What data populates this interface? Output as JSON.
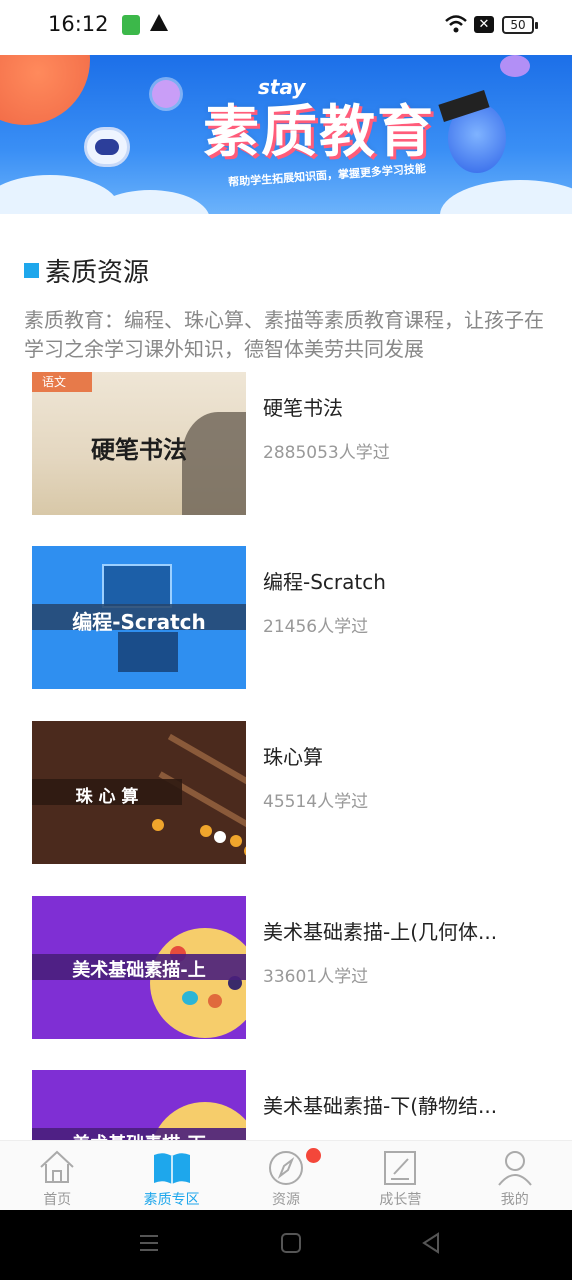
{
  "status_bar": {
    "time": "16:12",
    "battery": "50"
  },
  "banner": {
    "en_text": "stay",
    "title": "素质教育",
    "subtitle": "帮助学生拓展知识面，掌握更多学习技能"
  },
  "section": {
    "title": "素质资源",
    "description": "素质教育：编程、珠心算、素描等素质教育课程，让孩子在学习之余学习课外知识，德智体美劳共同发展"
  },
  "courses": [
    {
      "name": "硬笔书法",
      "count": "2885053人学过",
      "thumb_title": "硬笔书法",
      "thumb_tag": "语文"
    },
    {
      "name": "编程-Scratch",
      "count": "21456人学过",
      "thumb_title": "编程-Scratch"
    },
    {
      "name": "珠心算",
      "count": "45514人学过",
      "thumb_title": "珠 心 算"
    },
    {
      "name": "美术基础素描-上(几何体...",
      "count": "33601人学过",
      "thumb_title": "美术基础素描-上"
    },
    {
      "name": "美术基础素描-下(静物结...",
      "count": "",
      "thumb_title": "美术基础素描-下"
    }
  ],
  "tabs": [
    {
      "label": "首页",
      "icon": "home-icon"
    },
    {
      "label": "素质专区",
      "icon": "book-icon"
    },
    {
      "label": "资源",
      "icon": "compass-icon"
    },
    {
      "label": "成长营",
      "icon": "edit-icon"
    },
    {
      "label": "我的",
      "icon": "user-icon"
    }
  ],
  "colors": {
    "accent": "#1ea7ec",
    "badge": "#f4473a",
    "purple": "#7f2fd4",
    "blue": "#2f8ff0",
    "brown": "#4b2a1d"
  }
}
